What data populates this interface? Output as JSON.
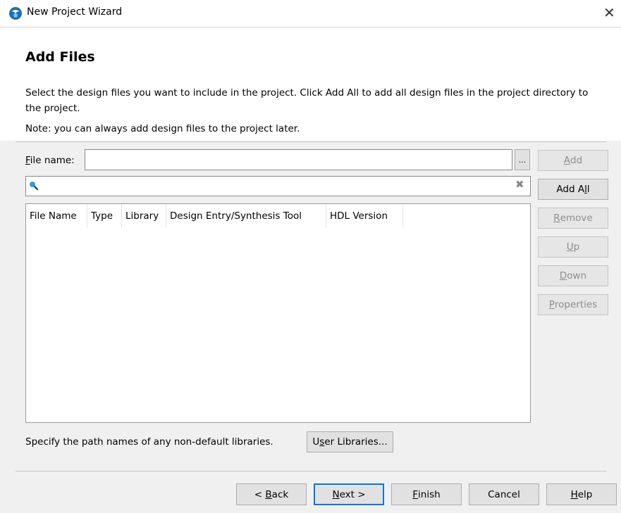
{
  "window": {
    "title": "New Project Wizard"
  },
  "page": {
    "title": "Add Files",
    "description": "Select the design files you want to include in the project. Click Add All to add all design files in the project directory to the project.",
    "note": "Note: you can always add design files to the project later."
  },
  "file_name": {
    "label_prefix": "",
    "label_underlined": "F",
    "label_rest": "ile name:",
    "value": "",
    "browse_label": "..."
  },
  "search": {
    "value": "",
    "clear_label": "✖"
  },
  "table": {
    "columns": [
      "File Name",
      "Type",
      "Library",
      "Design Entry/Synthesis Tool",
      "HDL Version"
    ],
    "rows": []
  },
  "side_buttons": {
    "add": {
      "label_underlined": "A",
      "label_rest": "dd"
    },
    "add_all": {
      "label_prefix": "Add A",
      "label_underlined": "l",
      "label_rest": "l"
    },
    "remove": {
      "label_underlined": "R",
      "label_rest": "emove"
    },
    "up": {
      "label_underlined": "U",
      "label_rest": "p"
    },
    "down": {
      "label_underlined": "D",
      "label_rest": "own"
    },
    "properties": {
      "label_underlined": "P",
      "label_rest": "roperties"
    }
  },
  "libraries": {
    "text": "Specify the path names of any non-default libraries.",
    "button_prefix": "U",
    "button_underlined": "s",
    "button_rest": "er Libraries..."
  },
  "footer": {
    "back": {
      "prefix": "< ",
      "underlined": "B",
      "rest": "ack"
    },
    "next": {
      "underlined": "N",
      "rest": "ext >"
    },
    "finish": {
      "underlined": "F",
      "rest": "inish"
    },
    "cancel": {
      "label": "Cancel"
    },
    "help": {
      "underlined": "H",
      "rest": "elp"
    }
  }
}
